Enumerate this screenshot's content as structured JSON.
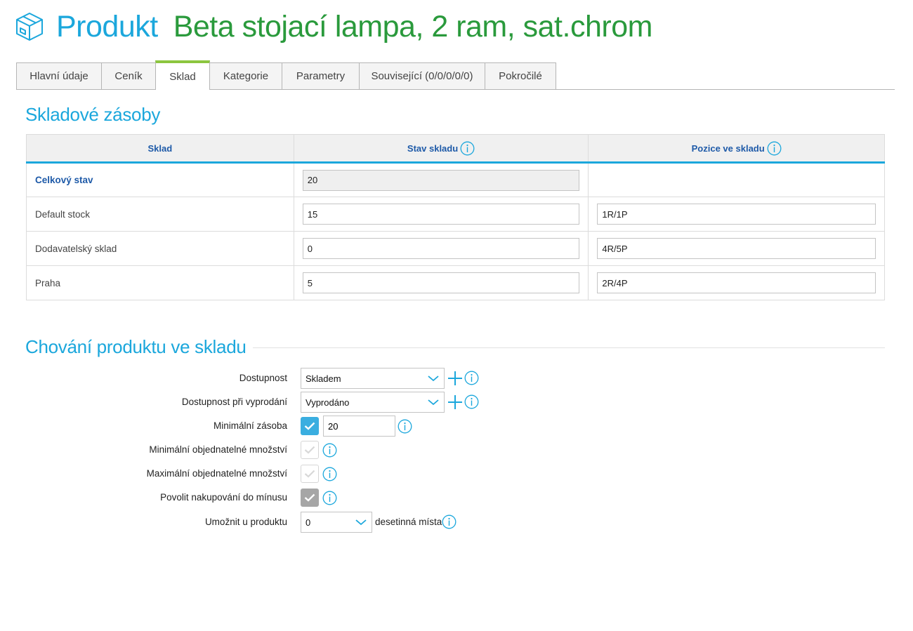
{
  "header": {
    "label": "Produkt",
    "title": "Beta stojací lampa, 2 ram, sat.chrom"
  },
  "tabs": [
    {
      "label": "Hlavní údaje",
      "active": false
    },
    {
      "label": "Ceník",
      "active": false
    },
    {
      "label": "Sklad",
      "active": true
    },
    {
      "label": "Kategorie",
      "active": false
    },
    {
      "label": "Parametry",
      "active": false
    },
    {
      "label": "Související (0/0/0/0/0)",
      "active": false
    },
    {
      "label": "Pokročilé",
      "active": false
    }
  ],
  "stock": {
    "title": "Skladové zásoby",
    "columns": [
      "Sklad",
      "Stav skladu",
      "Pozice ve skladu"
    ],
    "rows": [
      {
        "name": "Celkový stav",
        "qty": "20",
        "position": ""
      },
      {
        "name": "Default stock",
        "qty": "15",
        "position": "1R/1P"
      },
      {
        "name": "Dodavatelský sklad",
        "qty": "0",
        "position": "4R/5P"
      },
      {
        "name": "Praha",
        "qty": "5",
        "position": "2R/4P"
      }
    ]
  },
  "behavior": {
    "title": "Chování produktu ve skladu",
    "availability": {
      "label": "Dostupnost",
      "value": "Skladem"
    },
    "availability_soldout": {
      "label": "Dostupnost při vyprodání",
      "value": "Vyprodáno"
    },
    "min_stock": {
      "label": "Minimální zásoba",
      "checked": true,
      "value": "20"
    },
    "min_order_qty": {
      "label": "Minimální objednatelné množství",
      "checked": false
    },
    "max_order_qty": {
      "label": "Maximální objednatelné množství",
      "checked": false
    },
    "allow_negative": {
      "label": "Povolit nakupování do mínusu",
      "checked": true
    },
    "decimals": {
      "label": "Umožnit u produktu",
      "value": "0",
      "suffix": "desetinná místa"
    }
  },
  "colors": {
    "accent": "#1ba7dc",
    "title_green": "#2a9a3c",
    "tab_active": "#8cc63f"
  }
}
